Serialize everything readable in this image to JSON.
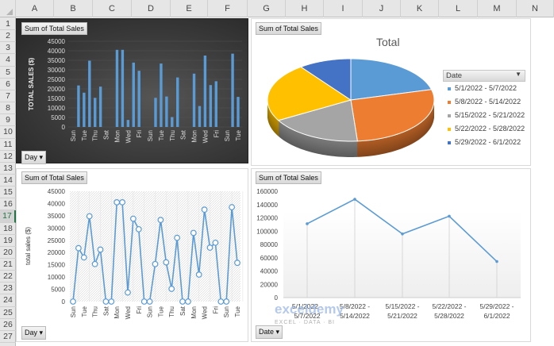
{
  "spreadsheet": {
    "columns": [
      "A",
      "B",
      "C",
      "D",
      "E",
      "F",
      "G",
      "H",
      "I",
      "J",
      "K",
      "L",
      "M",
      "N"
    ],
    "rows": [
      "1",
      "2",
      "3",
      "4",
      "5",
      "6",
      "7",
      "8",
      "9",
      "10",
      "11",
      "12",
      "13",
      "14",
      "15",
      "16",
      "17",
      "18",
      "19",
      "20",
      "21",
      "22",
      "23",
      "24",
      "25",
      "26",
      "27"
    ],
    "selected_row": "17"
  },
  "watermark": {
    "brand": "exceldemy",
    "tagline": "EXCEL · DATA · BI"
  },
  "colors": {
    "accent": "#5b9bd5",
    "dark_bg": "#3a3a3a"
  },
  "chart_data": [
    {
      "type": "bar",
      "field_button": "Sum of Total Sales",
      "axis_button": "Day",
      "ylabel": "TOTAL SALES ($)",
      "ylim": [
        0,
        45000
      ],
      "yticks": [
        "0",
        "5000",
        "10000",
        "15000",
        "20000",
        "25000",
        "30000",
        "35000",
        "40000",
        "45000"
      ],
      "x_tick_labels": [
        "Sun",
        "Tue",
        "Thu",
        "Sat",
        "Mon",
        "Wed",
        "Fri",
        "Sun",
        "Tue",
        "Thu",
        "Sat",
        "Mon",
        "Wed",
        "Fri",
        "Sun",
        "Tue"
      ],
      "values": [
        0,
        21800,
        18000,
        34800,
        15300,
        21200,
        0,
        0,
        40500,
        40500,
        3700,
        33800,
        29500,
        0,
        0,
        15300,
        33300,
        16000,
        5200,
        26000,
        0,
        0,
        28000,
        11000,
        37500,
        22000,
        24000,
        0,
        0,
        38500,
        15800
      ],
      "grid": true,
      "background": "dark"
    },
    {
      "type": "pie",
      "field_button": "Sum of Total Sales",
      "title": "Total",
      "legend_button": "Date",
      "legend_position": "right",
      "categories": [
        "5/1/2022 - 5/7/2022",
        "5/8/2022 - 5/14/2022",
        "5/15/2022 - 5/21/2022",
        "5/22/2022 - 5/28/2022",
        "5/29/2022 - 6/1/2022"
      ],
      "values": [
        111100,
        148000,
        95800,
        122500,
        54300
      ],
      "colors": [
        "#5b9bd5",
        "#ed7d31",
        "#a5a5a5",
        "#ffc000",
        "#4472c4"
      ],
      "style": "3d"
    },
    {
      "type": "line",
      "field_button": "Sum of Total Sales",
      "axis_button": "Day",
      "ylabel": "total sales ($)",
      "ylim": [
        0,
        45000
      ],
      "yticks": [
        "0",
        "5000",
        "10000",
        "15000",
        "20000",
        "25000",
        "30000",
        "35000",
        "40000",
        "45000"
      ],
      "x_tick_labels": [
        "Sun",
        "Tue",
        "Thu",
        "Sat",
        "Mon",
        "Wed",
        "Fri",
        "Sun",
        "Tue",
        "Thu",
        "Sat",
        "Mon",
        "Wed",
        "Fri",
        "Sun",
        "Tue"
      ],
      "values": [
        0,
        21800,
        18000,
        34800,
        15300,
        21200,
        0,
        0,
        40500,
        40500,
        3700,
        33800,
        29500,
        0,
        0,
        15300,
        33300,
        16000,
        5200,
        26000,
        0,
        0,
        28000,
        11000,
        37500,
        22000,
        24000,
        0,
        0,
        38500,
        15800
      ],
      "markers": true
    },
    {
      "type": "line",
      "field_button": "Sum of Total Sales",
      "axis_button": "Date",
      "ylim": [
        0,
        160000
      ],
      "yticks": [
        "0",
        "20000",
        "40000",
        "60000",
        "80000",
        "100000",
        "120000",
        "140000",
        "160000"
      ],
      "categories": [
        [
          "5/1/2022 -",
          "5/7/2022"
        ],
        [
          "5/8/2022 -",
          "5/14/2022"
        ],
        [
          "5/15/2022 -",
          "5/21/2022"
        ],
        [
          "5/22/2022 -",
          "5/28/2022"
        ],
        [
          "5/29/2022 -",
          "6/1/2022"
        ]
      ],
      "values": [
        111100,
        148000,
        95800,
        122500,
        54300
      ],
      "drop_lines": true
    }
  ]
}
